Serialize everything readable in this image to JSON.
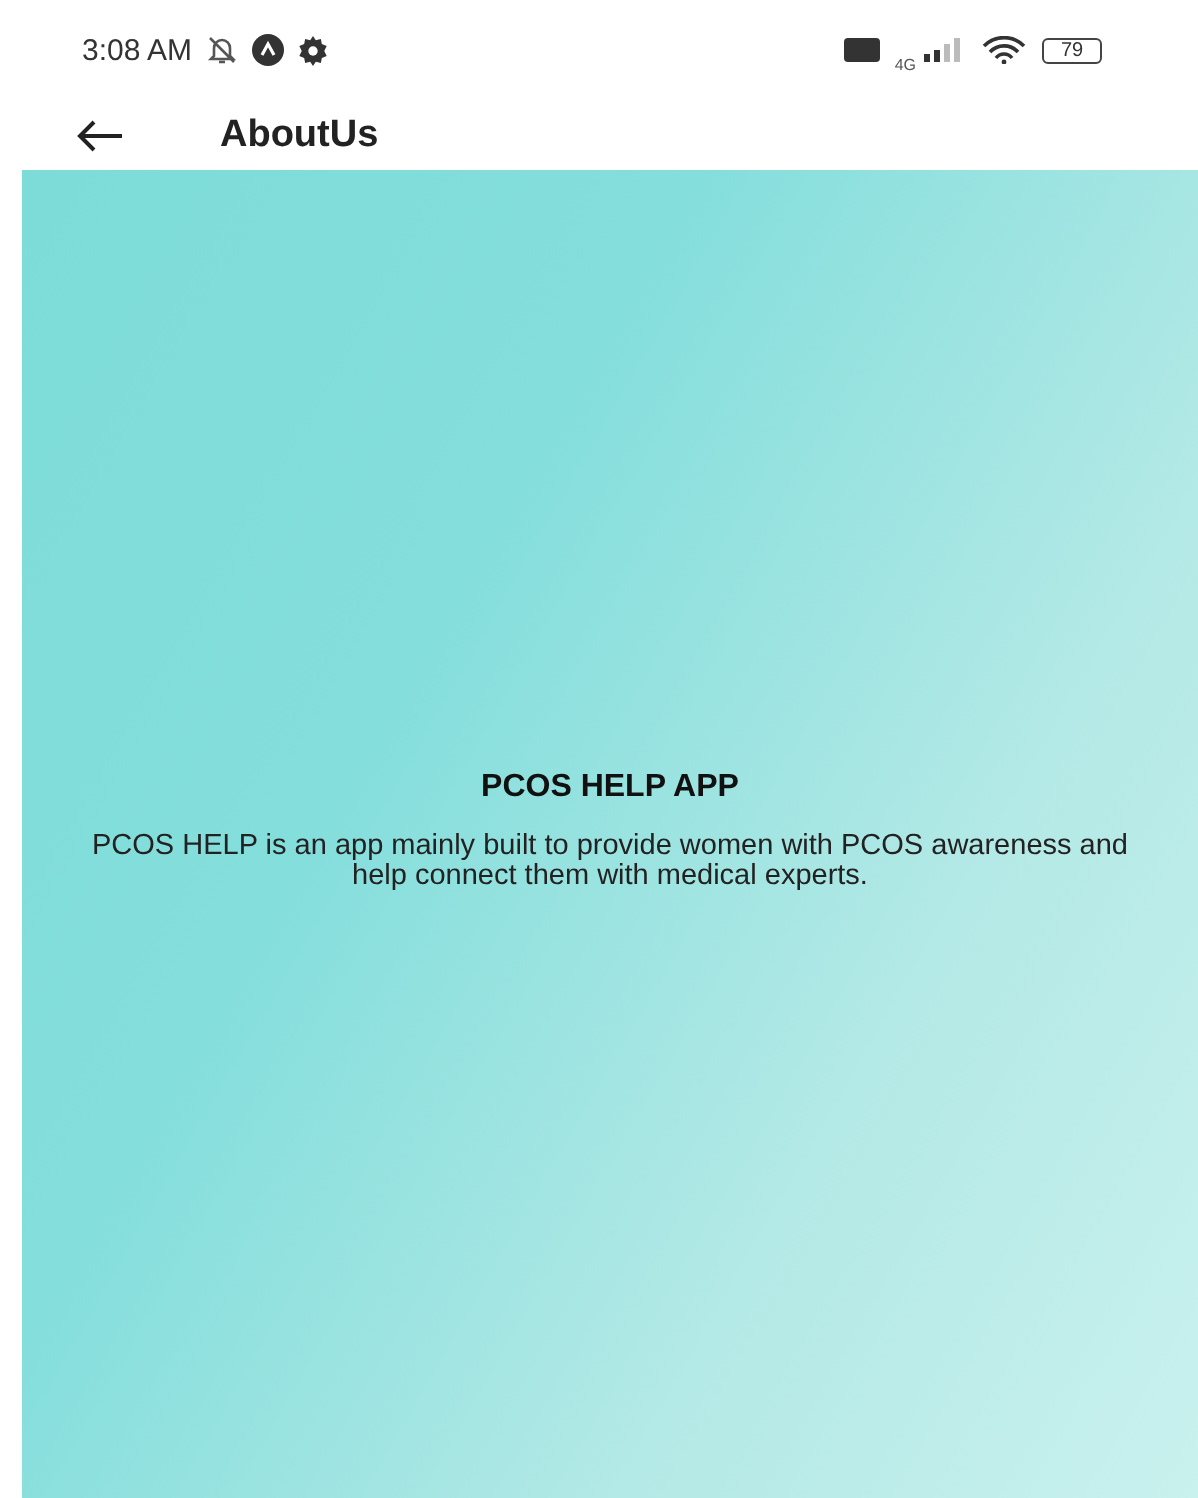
{
  "status_bar": {
    "time": "3:08 AM",
    "network": "4G",
    "battery": "79"
  },
  "app_bar": {
    "title": "AboutUs"
  },
  "about": {
    "heading": "PCOS HELP APP",
    "body": "PCOS HELP is an app mainly built to provide women with PCOS awareness and help connect them with medical experts."
  }
}
